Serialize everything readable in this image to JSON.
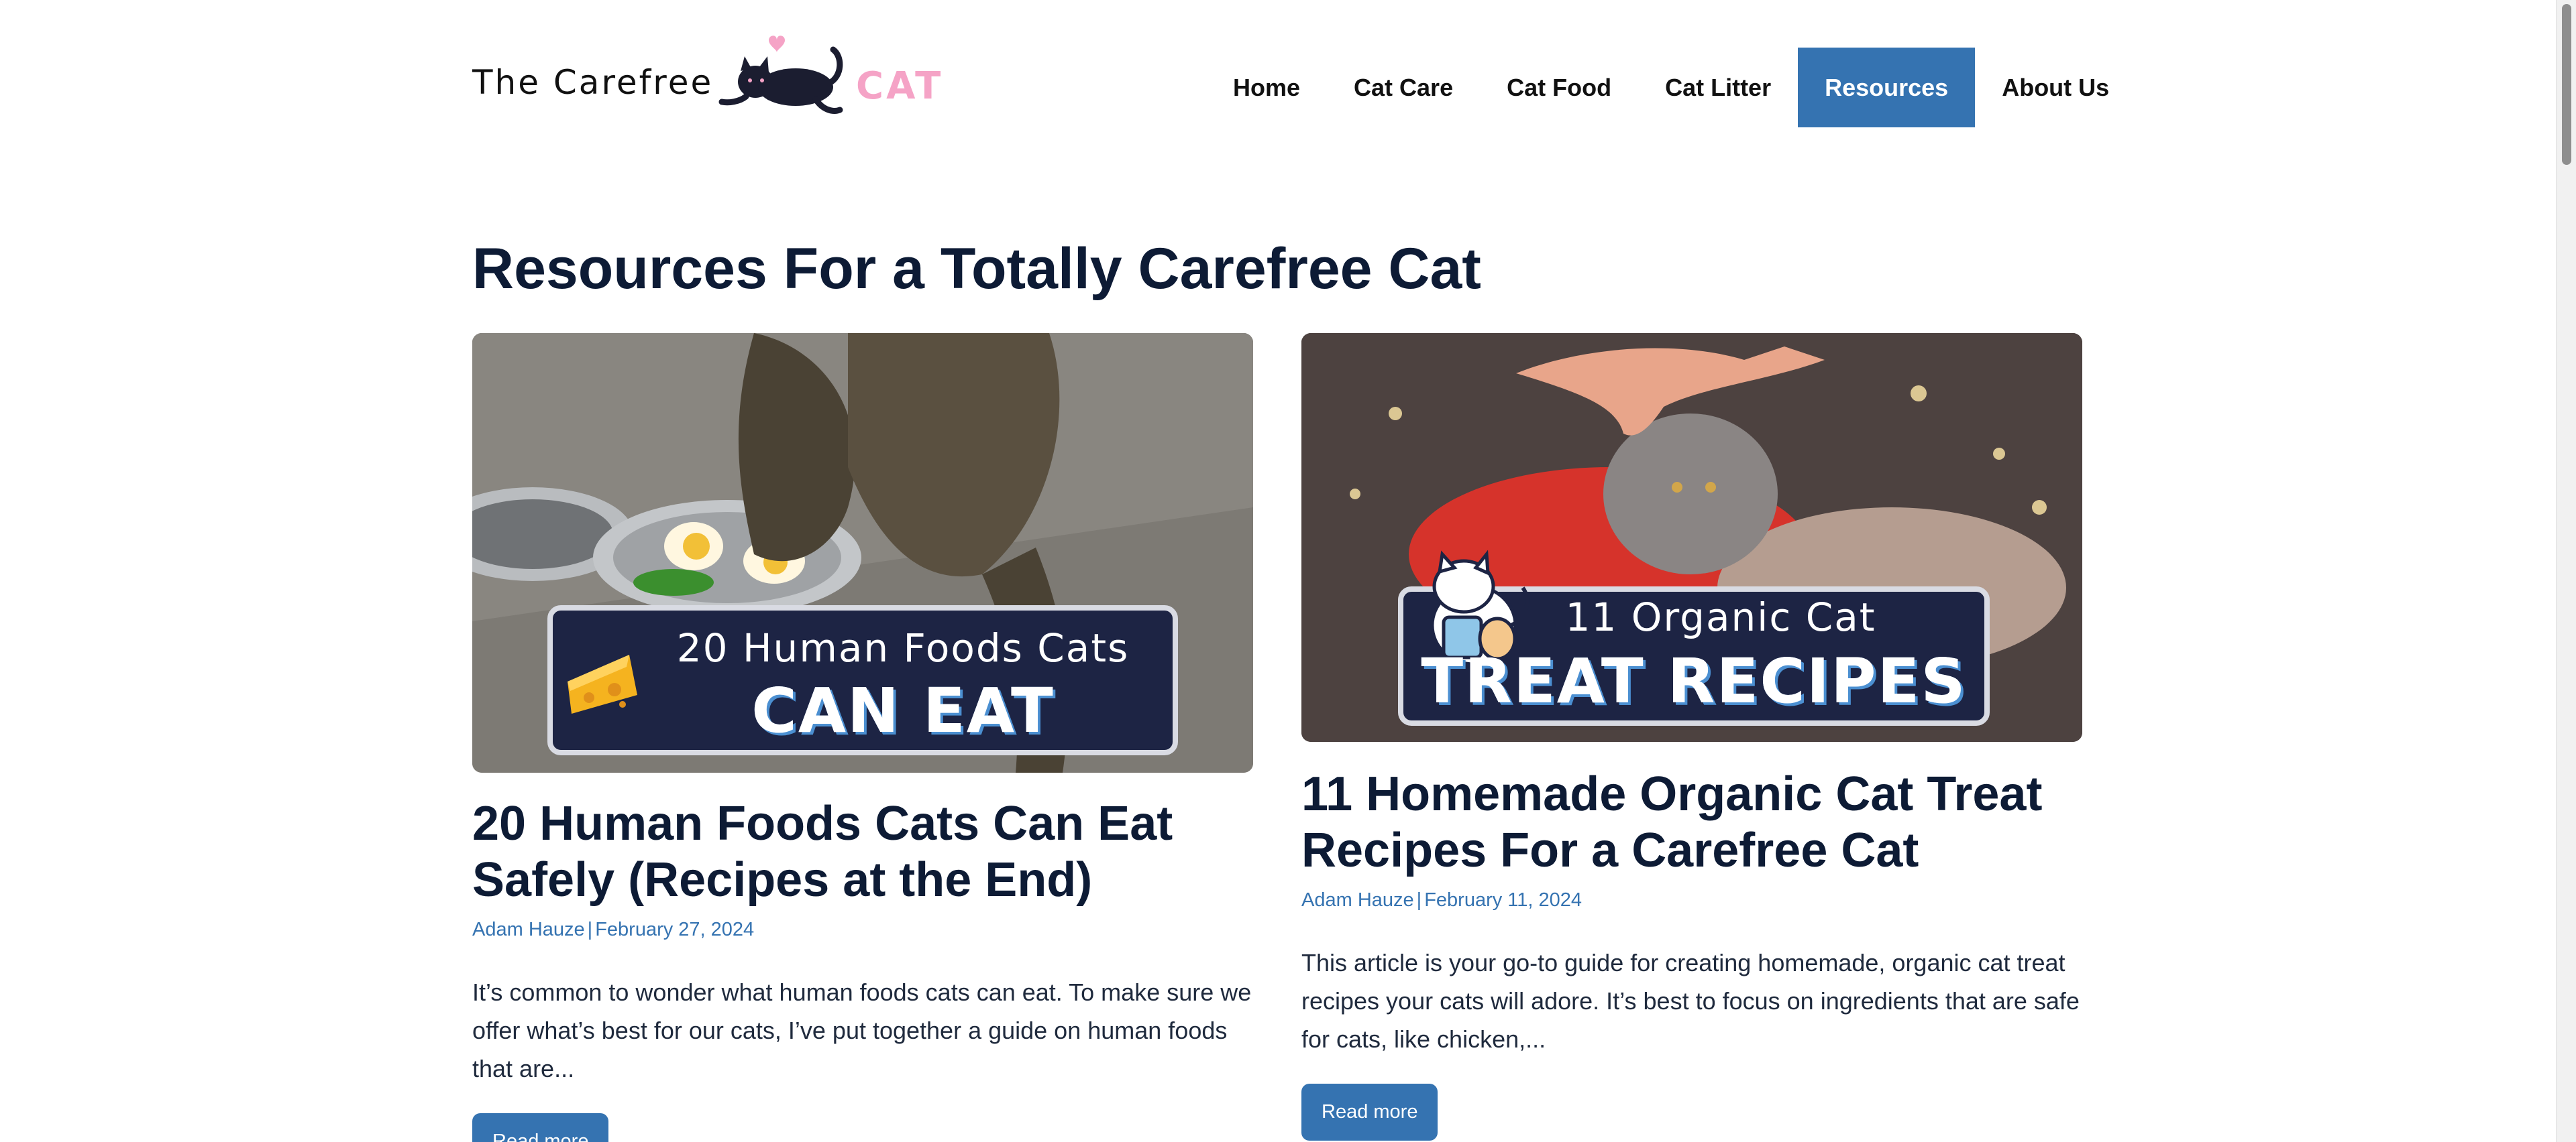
{
  "header": {
    "logo_text": "The Carefree",
    "logo_accent": "CAT",
    "nav": [
      {
        "label": "Home"
      },
      {
        "label": "Cat Care"
      },
      {
        "label": "Cat Food"
      },
      {
        "label": "Cat Litter"
      },
      {
        "label": "Resources",
        "active": true
      },
      {
        "label": "About Us"
      }
    ]
  },
  "main": {
    "page_title": "Resources For a Totally Carefree Cat",
    "posts": [
      {
        "image_banner_sub": "20 Human Foods Cats",
        "image_banner_main": "CAN EAT",
        "title": "20 Human Foods Cats Can Eat Safely (Recipes at the End)",
        "author": "Adam Hauze",
        "date": "February 27, 2024",
        "excerpt": "It’s common to wonder what human foods cats can eat. To make sure we offer what’s best for our cats, I’ve put together a guide on human foods that are...",
        "read_more": "Read more"
      },
      {
        "image_banner_sub": "11 Organic Cat",
        "image_banner_main": "TREAT RECIPES",
        "title": "11 Homemade Organic Cat Treat Recipes For a Carefree Cat",
        "author": "Adam Hauze",
        "date": "February 11, 2024",
        "excerpt": "This article is your go-to guide for creating homemade, organic cat treat recipes your cats will adore. It’s best to focus on ingredients that are safe for cats, like chicken,...",
        "read_more": "Read more"
      }
    ]
  },
  "colors": {
    "accent": "#3573b1",
    "logo_pink": "#f5a3c6",
    "heading": "#0d1b35"
  },
  "icons": [
    "cat-logo-icon",
    "heart-icon",
    "cheese-icon",
    "cat-mascot-icon"
  ]
}
